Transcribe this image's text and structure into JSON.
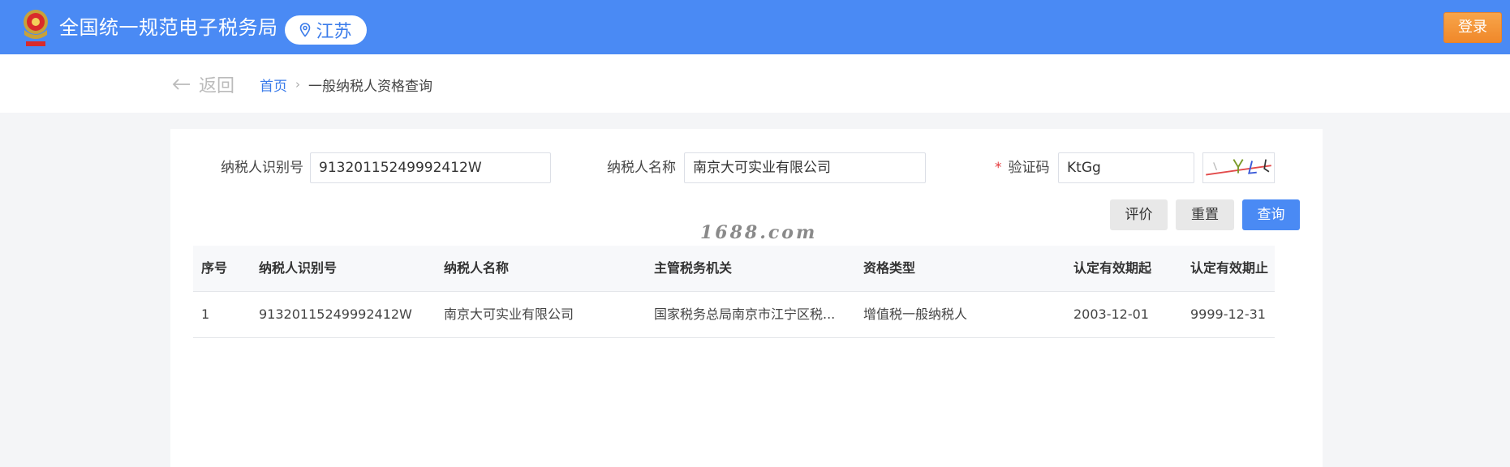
{
  "header": {
    "app_title": "全国统一规范电子税务局",
    "region": "江苏",
    "login_label": "登录",
    "brand_color": "#4a8af4",
    "login_color": "#f0882a",
    "logo_icon": "tax-emblem-icon",
    "region_icon": "location-pin-icon"
  },
  "breadcrumb": {
    "back_label": "返回",
    "back_icon": "arrow-left-icon",
    "home": "首页",
    "separator": "›",
    "current": "一般纳税人资格查询"
  },
  "form": {
    "taxpayer_id_label": "纳税人识别号",
    "taxpayer_id_value": "91320115249992412W",
    "taxpayer_name_label": "纳税人名称",
    "taxpayer_name_value": "南京大可实业有限公司",
    "captcha_required_mark": "*",
    "captcha_label": "验证码",
    "captcha_value": "KtGg"
  },
  "actions": {
    "evaluate": "评价",
    "reset": "重置",
    "query": "查询"
  },
  "watermark": "1688.com",
  "table": {
    "columns": [
      "序号",
      "纳税人识别号",
      "纳税人名称",
      "主管税务机关",
      "资格类型",
      "认定有效期起",
      "认定有效期止"
    ],
    "rows": [
      [
        "1",
        "91320115249992412W",
        "南京大可实业有限公司",
        "国家税务总局南京市江宁区税...",
        "增值税一般纳税人",
        "2003-12-01",
        "9999-12-31"
      ]
    ]
  }
}
